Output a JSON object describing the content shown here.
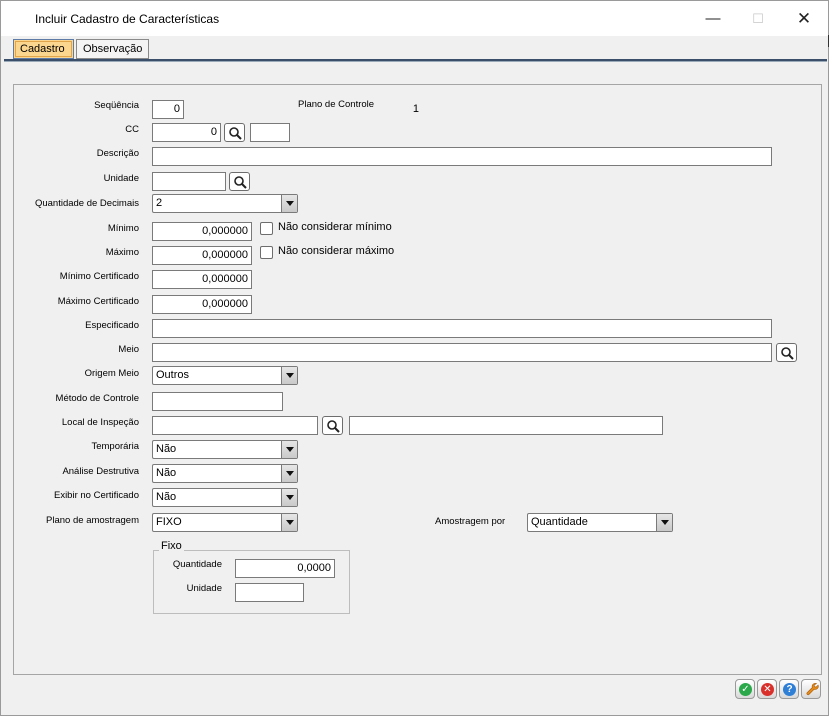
{
  "window": {
    "title": "Incluir Cadastro de Características",
    "minimize_glyph": "—",
    "maximize_glyph": "☐",
    "close_glyph": "✕"
  },
  "tabs": [
    {
      "label": "Cadastro",
      "active": true
    },
    {
      "label": "Observação",
      "active": false
    }
  ],
  "form": {
    "sequencia": {
      "label": "Seqüência",
      "value": "0"
    },
    "plano_controle": {
      "label": "Plano de Controle",
      "value": "1"
    },
    "cc": {
      "label": "CC",
      "value": "0",
      "desc": ""
    },
    "descricao": {
      "label": "Descrição",
      "value": ""
    },
    "unidade": {
      "label": "Unidade",
      "value": ""
    },
    "qtd_decimais": {
      "label": "Quantidade de Decimais",
      "value": "2"
    },
    "minimo": {
      "label": "Mínimo",
      "value": "0,000000",
      "check_label": "Não considerar mínimo",
      "checked": false
    },
    "maximo": {
      "label": "Máximo",
      "value": "0,000000",
      "check_label": "Não considerar máximo",
      "checked": false
    },
    "minimo_cert": {
      "label": "Mínimo Certificado",
      "value": "0,000000"
    },
    "maximo_cert": {
      "label": "Máximo Certificado",
      "value": "0,000000"
    },
    "especificado": {
      "label": "Especificado",
      "value": ""
    },
    "meio": {
      "label": "Meio",
      "value": ""
    },
    "origem_meio": {
      "label": "Origem Meio",
      "value": "Outros"
    },
    "metodo_controle": {
      "label": "Método de Controle",
      "value": ""
    },
    "local_inspecao": {
      "label": "Local de Inspeção",
      "value": "",
      "desc": ""
    },
    "temporaria": {
      "label": "Temporária",
      "value": "Não"
    },
    "analise_destrutiva": {
      "label": "Análise Destrutiva",
      "value": "Não"
    },
    "exibir_certificado": {
      "label": "Exibir no Certificado",
      "value": "Não"
    },
    "plano_amostragem": {
      "label": "Plano de amostragem",
      "value": "FIXO"
    },
    "amostragem_por": {
      "label": "Amostragem por",
      "value": "Quantidade"
    },
    "fixo": {
      "legend": "Fixo",
      "quantidade": {
        "label": "Quantidade",
        "value": "0,0000"
      },
      "unidade": {
        "label": "Unidade",
        "value": ""
      }
    }
  },
  "footer": {
    "buttons": [
      {
        "name": "confirm-button",
        "icon": "check-icon",
        "glyph": "✓",
        "color": "#2aa84a"
      },
      {
        "name": "cancel-button",
        "icon": "cancel-icon",
        "glyph": "✕",
        "color": "#d9302c"
      },
      {
        "name": "help-button",
        "icon": "help-icon",
        "glyph": "?",
        "color": "#2f7fd6"
      },
      {
        "name": "tools-button",
        "icon": "wrench-icon",
        "glyph": "",
        "color": "#e48a1a"
      }
    ]
  },
  "colors": {
    "active_tab": "#fbd68e",
    "window_bg": "#f0f0f0"
  }
}
